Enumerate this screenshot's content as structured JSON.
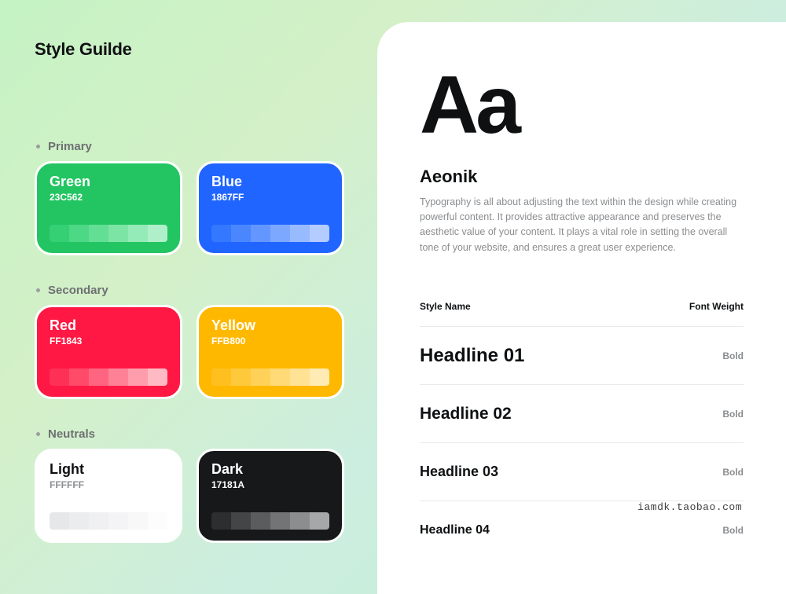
{
  "page_title": "Style Guilde",
  "sections": {
    "primary": {
      "label": "Primary"
    },
    "secondary": {
      "label": "Secondary"
    },
    "neutrals": {
      "label": "Neutrals"
    }
  },
  "colors": {
    "green": {
      "name": "Green",
      "hex": "23C562",
      "ramp": [
        "#36d074",
        "#4cd884",
        "#63de95",
        "#7ce5a6",
        "#95ebb8",
        "#afefc9"
      ]
    },
    "blue": {
      "name": "Blue",
      "hex": "1867FF",
      "ramp": [
        "#3478ff",
        "#4a87ff",
        "#6397ff",
        "#7da8ff",
        "#98baff",
        "#b4ccff"
      ]
    },
    "red": {
      "name": "Red",
      "hex": "FF1843",
      "ramp": [
        "#ff3056",
        "#ff4a6a",
        "#ff6580",
        "#ff8196",
        "#ff9dac",
        "#ffbac3"
      ]
    },
    "yellow": {
      "name": "Yellow",
      "hex": "FFB800",
      "ramp": [
        "#ffc01f",
        "#ffc93c",
        "#ffd158",
        "#ffda76",
        "#ffe294",
        "#ffebb3"
      ]
    },
    "light": {
      "name": "Light",
      "hex": "FFFFFF",
      "ramp": [
        "#e6e7e9",
        "#ebeced",
        "#f0f0f2",
        "#f4f4f6",
        "#f8f8f9",
        "#fcfcfd"
      ]
    },
    "dark": {
      "name": "Dark",
      "hex": "17181A",
      "ramp": [
        "#2d2e30",
        "#444547",
        "#5b5c5e",
        "#737476",
        "#8c8d8f",
        "#a6a7a8"
      ]
    }
  },
  "typography": {
    "specimen": "Aa",
    "font_name": "Aeonik",
    "description": "Typography is all about adjusting the text within the design while creating powerful content. It provides attractive appearance and preserves the aesthetic value of your content. It plays a vital role in setting the overall tone of your website, and ensures a great user experience.",
    "table_header": {
      "style": "Style Name",
      "weight": "Font Weight"
    },
    "styles": [
      {
        "name": "Headline 01",
        "weight": "Bold"
      },
      {
        "name": "Headline 02",
        "weight": "Bold"
      },
      {
        "name": "Headline 03",
        "weight": "Bold"
      },
      {
        "name": "Headline 04",
        "weight": "Bold"
      }
    ]
  },
  "watermark": "iamdk.taobao.com"
}
